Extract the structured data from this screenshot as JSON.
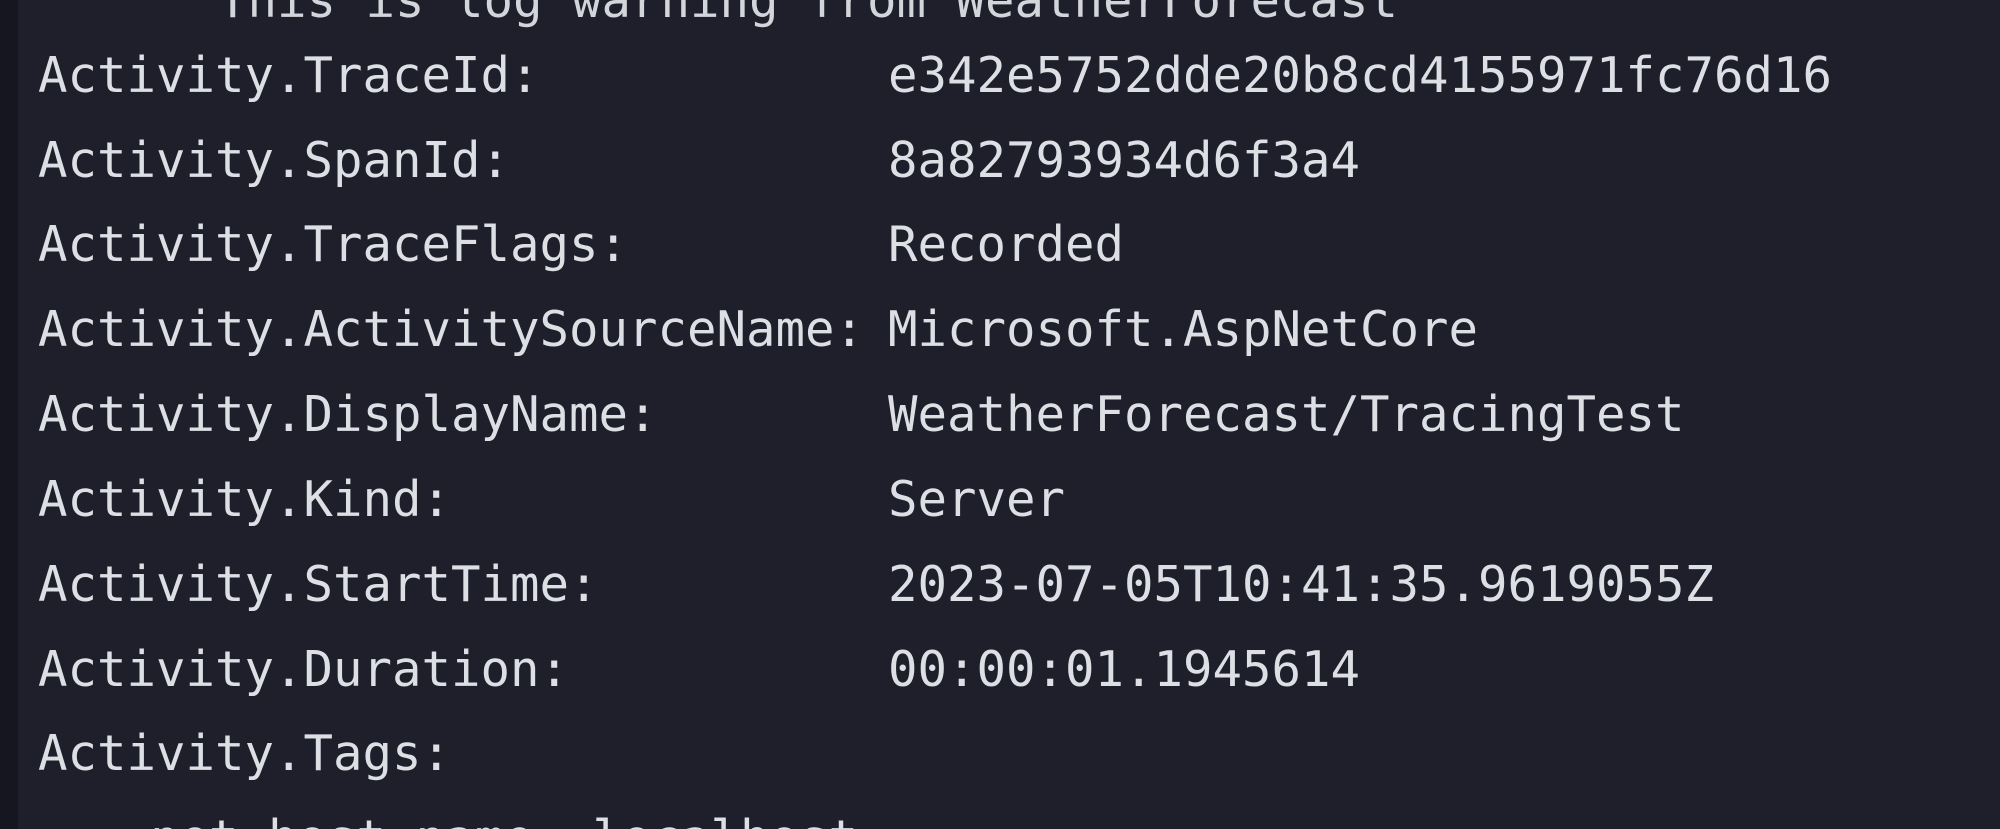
{
  "theme": {
    "background": "#1e1f2a",
    "text": "#dcdfe4",
    "left_border": "#151620"
  },
  "log": {
    "clipped_top_line": "This is log warning from WeatherForecast",
    "entries": [
      {
        "key": "Activity.TraceId:",
        "value": "e342e5752dde20b8cd4155971fc76d16"
      },
      {
        "key": "Activity.SpanId:",
        "value": "8a82793934d6f3a4"
      },
      {
        "key": "Activity.TraceFlags:",
        "value": "Recorded"
      },
      {
        "key": "Activity.ActivitySourceName:",
        "value": "Microsoft.AspNetCore"
      },
      {
        "key": "Activity.DisplayName:",
        "value": "WeatherForecast/TracingTest"
      },
      {
        "key": "Activity.Kind:",
        "value": "Server"
      },
      {
        "key": "Activity.StartTime:",
        "value": "2023-07-05T10:41:35.9619055Z"
      },
      {
        "key": "Activity.Duration:",
        "value": "00:00:01.1945614"
      },
      {
        "key": "Activity.Tags:",
        "value": ""
      }
    ],
    "clipped_bottom_line": "net.host.name: localhost"
  }
}
